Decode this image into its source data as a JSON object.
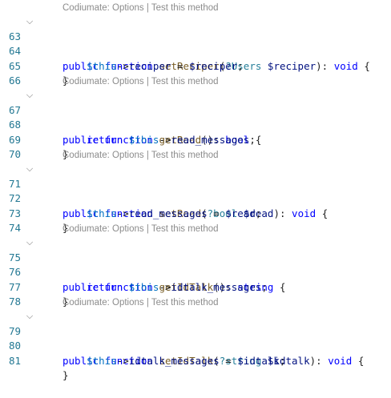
{
  "gutter": {
    "lines": [
      "63",
      "64",
      "65",
      "66",
      "67",
      "68",
      "69",
      "70",
      "71",
      "72",
      "73",
      "74",
      "75",
      "76",
      "77",
      "78",
      "79",
      "80",
      "81"
    ]
  },
  "codelens": {
    "prefix": "Codiumate: ",
    "options": "Options",
    "separator": " | ",
    "test": "Test this method"
  },
  "code": {
    "l63": {
      "kw1": "public",
      "kw2": "function",
      "name": "setReciper",
      "open": "(",
      "type": "?Users",
      "param": "$reciper",
      "close": "): ",
      "ret": "void",
      "brace": "{"
    },
    "l64": {
      "this": "$this",
      "arrow": "->",
      "prop": "reciper",
      "eq": " = ",
      "val": "$reciper",
      "end": ";"
    },
    "l65": {
      "brace": "}"
    },
    "l67": {
      "kw1": "public",
      "kw2": "function",
      "name": "getRead",
      "open": "(",
      "close": "): ",
      "ret": "bool",
      "brace": "{"
    },
    "l68": {
      "kw": "return",
      "this": "$this",
      "arrow": "->",
      "prop": "read_messages",
      "end": ";"
    },
    "l69": {
      "brace": "}"
    },
    "l71": {
      "kw1": "public",
      "kw2": "function",
      "name": "setRead",
      "open": "(",
      "type": "?bool",
      "param": "$read",
      "close": "): ",
      "ret": "void",
      "brace": "{"
    },
    "l72": {
      "this": "$this",
      "arrow": "->",
      "prop": "read_messages",
      "eq": " = ",
      "val": "$read",
      "end": ";"
    },
    "l73": {
      "brace": "}"
    },
    "l75": {
      "kw1": "public",
      "kw2": "function",
      "name": "getIdTalk",
      "open": "(",
      "close": "): ",
      "ret": "string",
      "brace": "{"
    },
    "l76": {
      "kw": "return",
      "this": "$this",
      "arrow": "->",
      "prop": "idtalk_messages",
      "end": ";"
    },
    "l77": {
      "brace": "}"
    },
    "l79": {
      "kw1": "public",
      "kw2": "function",
      "name": "setIdTalk",
      "open": "(",
      "type": "?string",
      "param": "$idtalk",
      "close": "): ",
      "ret": "void",
      "brace": "{"
    },
    "l80": {
      "this": "$this",
      "arrow": "->",
      "prop": "idtalk_messages",
      "eq": " = ",
      "val": "$idtalk",
      "end": ";"
    },
    "l81": {
      "brace": "}"
    }
  },
  "colors": {
    "keyword": "#0000ff",
    "variable": "#001080",
    "line_number": "#237893",
    "codelens": "#8c8c8c"
  },
  "icons": {
    "fold": "chevron-down-icon"
  }
}
